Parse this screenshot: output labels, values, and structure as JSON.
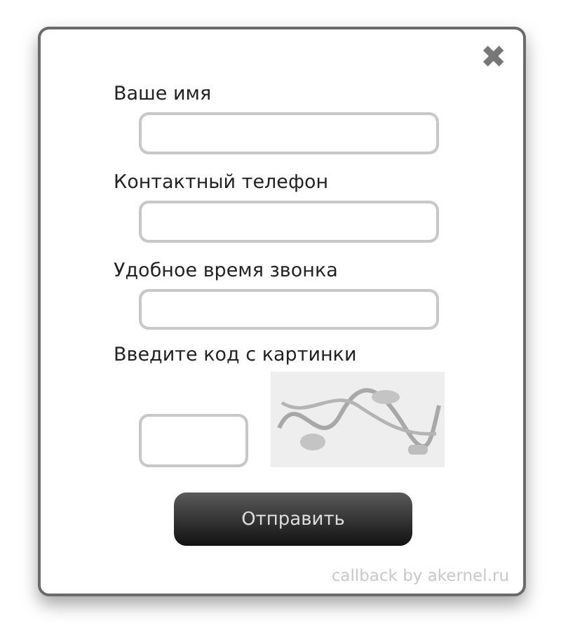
{
  "dialog": {
    "close": "✖",
    "fields": [
      {
        "label": "Ваше имя"
      },
      {
        "label": "Контактный телефон"
      },
      {
        "label": "Удобное время звонка"
      }
    ],
    "captcha": {
      "label": "Введите код с картинки"
    },
    "submit": "Отправить",
    "credit": "callback by akernel.ru"
  }
}
